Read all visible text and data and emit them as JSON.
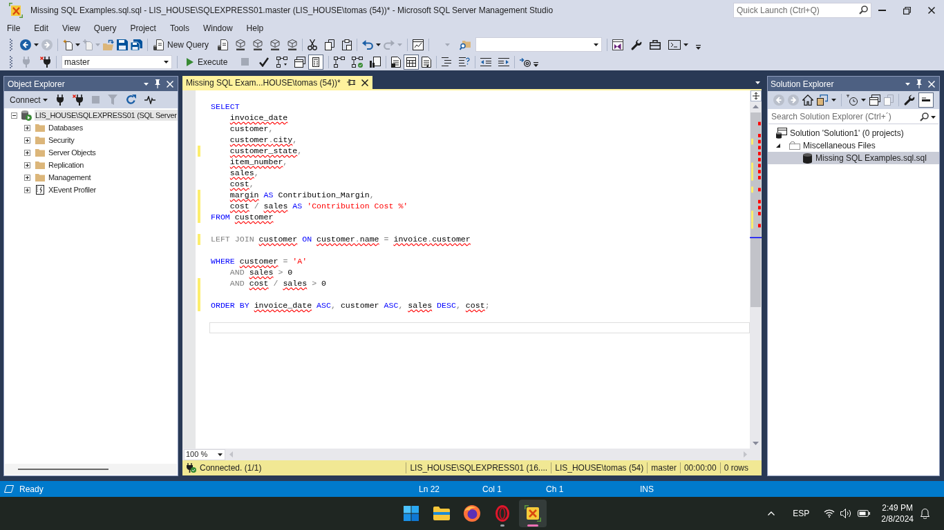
{
  "window": {
    "title": "Missing SQL Examples.sql.sql - LIS_HOUSE\\SQLEXPRESS01.master (LIS_HOUSE\\tomas (54))* - Microsoft SQL Server Management Studio",
    "quick_launch": {
      "placeholder": "Quick Launch (Ctrl+Q)"
    }
  },
  "menu": [
    "File",
    "Edit",
    "View",
    "Query",
    "Project",
    "Tools",
    "Window",
    "Help"
  ],
  "toolbar": {
    "new_query": "New Query",
    "database": "master",
    "execute": "Execute"
  },
  "object_explorer": {
    "title": "Object Explorer",
    "connect": "Connect",
    "tree": [
      {
        "label": "LIS_HOUSE\\SQLEXPRESS01 (SQL Server",
        "kind": "server",
        "expanded": true,
        "selected": true,
        "children": [
          {
            "label": "Databases",
            "kind": "folder",
            "expanded": false,
            "selected": false
          },
          {
            "label": "Security",
            "kind": "folder",
            "expanded": false,
            "selected": false
          },
          {
            "label": "Server Objects",
            "kind": "folder",
            "expanded": false,
            "selected": false
          },
          {
            "label": "Replication",
            "kind": "folder",
            "expanded": false,
            "selected": false
          },
          {
            "label": "Management",
            "kind": "folder",
            "expanded": false,
            "selected": false
          },
          {
            "label": "XEvent Profiler",
            "kind": "profiler",
            "expanded": false,
            "selected": false
          }
        ]
      }
    ]
  },
  "editor": {
    "tabs": [
      {
        "title": "Missing SQL Exam...HOUSE\\tomas (54))*",
        "selected": true
      }
    ],
    "lines": [
      {
        "changed": false,
        "current": false
      },
      {
        "changed": false,
        "current": false,
        "indented": false,
        "tokens": [
          {
            "text": "SELECT",
            "kind": "keyword",
            "error": false
          }
        ]
      },
      {
        "changed": false,
        "current": false,
        "indented": true,
        "tokens": [
          {
            "text": "invoice_date",
            "kind": "identifier",
            "error": true
          }
        ]
      },
      {
        "changed": false,
        "current": false,
        "indented": true,
        "tokens": [
          {
            "text": "customer",
            "kind": "identifier",
            "error": false
          },
          {
            "text": ",",
            "kind": "operator",
            "error": false
          }
        ]
      },
      {
        "changed": false,
        "current": false,
        "indented": true,
        "tokens": [
          {
            "text": "customer",
            "kind": "identifier",
            "error": true
          },
          {
            "text": ".",
            "kind": "operator",
            "error": true
          },
          {
            "text": "city",
            "kind": "identifier",
            "error": true
          },
          {
            "text": ",",
            "kind": "operator",
            "error": false
          }
        ]
      },
      {
        "changed": true,
        "current": false,
        "indented": true,
        "tokens": [
          {
            "text": "customer_state",
            "kind": "identifier",
            "error": true
          },
          {
            "text": ",",
            "kind": "operator",
            "error": false
          }
        ]
      },
      {
        "changed": false,
        "current": false,
        "indented": true,
        "tokens": [
          {
            "text": "item_number",
            "kind": "identifier",
            "error": true
          },
          {
            "text": ",",
            "kind": "operator",
            "error": false
          }
        ]
      },
      {
        "changed": false,
        "current": false,
        "indented": true,
        "tokens": [
          {
            "text": "sales",
            "kind": "identifier",
            "error": true
          },
          {
            "text": ",",
            "kind": "operator",
            "error": false
          }
        ]
      },
      {
        "changed": false,
        "current": false,
        "indented": true,
        "tokens": [
          {
            "text": "cost",
            "kind": "identifier",
            "error": true
          },
          {
            "text": ",",
            "kind": "operator",
            "error": false
          }
        ]
      },
      {
        "changed": true,
        "current": false,
        "indented": true,
        "tokens": [
          {
            "text": "margin",
            "kind": "identifier",
            "error": true
          },
          {
            "text": " AS ",
            "kind": "keyword",
            "error": false
          },
          {
            "text": "Contribution_Margin",
            "kind": "identifier",
            "error": false
          },
          {
            "text": ",",
            "kind": "operator",
            "error": false
          }
        ]
      },
      {
        "changed": true,
        "current": false,
        "indented": true,
        "tokens": [
          {
            "text": "cost",
            "kind": "identifier",
            "error": true
          },
          {
            "text": " / ",
            "kind": "operator",
            "error": false
          },
          {
            "text": "sales",
            "kind": "identifier",
            "error": true
          },
          {
            "text": " AS ",
            "kind": "keyword",
            "error": false
          },
          {
            "text": "'Contribution Cost %'",
            "kind": "string",
            "error": false
          }
        ]
      },
      {
        "changed": true,
        "current": false,
        "indented": false,
        "tokens": [
          {
            "text": "FROM ",
            "kind": "keyword",
            "error": false
          },
          {
            "text": "customer",
            "kind": "identifier",
            "error": true
          }
        ]
      },
      {
        "changed": false,
        "current": false
      },
      {
        "changed": true,
        "current": false,
        "indented": false,
        "tokens": [
          {
            "text": "LEFT JOIN ",
            "kind": "operator",
            "error": false
          },
          {
            "text": "customer",
            "kind": "identifier",
            "error": true
          },
          {
            "text": " ON ",
            "kind": "keyword",
            "error": false
          },
          {
            "text": "customer",
            "kind": "identifier",
            "error": true
          },
          {
            "text": ".",
            "kind": "operator",
            "error": true
          },
          {
            "text": "name",
            "kind": "identifier",
            "error": true
          },
          {
            "text": " = ",
            "kind": "operator",
            "error": false
          },
          {
            "text": "invoice",
            "kind": "identifier",
            "error": true
          },
          {
            "text": ".",
            "kind": "operator",
            "error": true
          },
          {
            "text": "customer",
            "kind": "identifier",
            "error": true
          }
        ]
      },
      {
        "changed": false,
        "current": false
      },
      {
        "changed": false,
        "current": false,
        "indented": false,
        "tokens": [
          {
            "text": "WHERE ",
            "kind": "keyword",
            "error": false
          },
          {
            "text": "customer",
            "kind": "identifier",
            "error": true
          },
          {
            "text": " = ",
            "kind": "operator",
            "error": false
          },
          {
            "text": "'A'",
            "kind": "string",
            "error": false
          }
        ]
      },
      {
        "changed": false,
        "current": false,
        "indented": true,
        "tokens": [
          {
            "text": "AND ",
            "kind": "operator",
            "error": false
          },
          {
            "text": "sales",
            "kind": "identifier",
            "error": true
          },
          {
            "text": " > ",
            "kind": "operator",
            "error": false
          },
          {
            "text": "0",
            "kind": "identifier",
            "error": false
          }
        ]
      },
      {
        "changed": true,
        "current": false,
        "indented": true,
        "tokens": [
          {
            "text": "AND ",
            "kind": "operator",
            "error": false
          },
          {
            "text": "cost",
            "kind": "identifier",
            "error": true
          },
          {
            "text": " / ",
            "kind": "operator",
            "error": false
          },
          {
            "text": "sales",
            "kind": "identifier",
            "error": true
          },
          {
            "text": " > ",
            "kind": "operator",
            "error": false
          },
          {
            "text": "0",
            "kind": "identifier",
            "error": false
          }
        ]
      },
      {
        "changed": true,
        "current": false
      },
      {
        "changed": true,
        "current": false,
        "indented": false,
        "tokens": [
          {
            "text": "ORDER BY ",
            "kind": "keyword",
            "error": false
          },
          {
            "text": "invoice_date",
            "kind": "identifier",
            "error": true
          },
          {
            "text": " ASC",
            "kind": "keyword",
            "error": false
          },
          {
            "text": ", ",
            "kind": "operator",
            "error": false
          },
          {
            "text": "customer",
            "kind": "identifier",
            "error": false
          },
          {
            "text": " ASC",
            "kind": "keyword",
            "error": false
          },
          {
            "text": ", ",
            "kind": "operator",
            "error": false
          },
          {
            "text": "sales",
            "kind": "identifier",
            "error": true
          },
          {
            "text": " DESC",
            "kind": "keyword",
            "error": false
          },
          {
            "text": ", ",
            "kind": "operator",
            "error": false
          },
          {
            "text": "cost",
            "kind": "identifier",
            "error": true
          },
          {
            "text": ";",
            "kind": "operator",
            "error": false
          }
        ]
      },
      {
        "changed": false,
        "current": false
      },
      {
        "changed": false,
        "current": true
      }
    ],
    "zoom": "100 %",
    "query_status": {
      "message": "Connected. (1/1)",
      "server": "LIS_HOUSE\\SQLEXPRESS01 (16....",
      "user": "LIS_HOUSE\\tomas (54)",
      "database": "master",
      "elapsed": "00:00:00",
      "rows": "0 rows"
    }
  },
  "solution_explorer": {
    "title": "Solution Explorer",
    "search": {
      "placeholder": "Search Solution Explorer (Ctrl+´)"
    },
    "tree": [
      {
        "label": "Solution 'Solution1' (0 projects)",
        "kind": "solution",
        "selected": false,
        "children": [
          {
            "label": "Miscellaneous Files",
            "kind": "folder",
            "expanded": true,
            "selected": false,
            "children": [
              {
                "label": "Missing SQL Examples.sql.sql",
                "kind": "file",
                "selected": true
              }
            ]
          }
        ]
      }
    ]
  },
  "status_bar": {
    "message": "Ready",
    "line": "Ln 22",
    "column": "Col 1",
    "character": "Ch 1",
    "mode": "INS"
  },
  "taskbar": {
    "language": "ESP",
    "time": "2:49 PM",
    "date": "2/8/2024"
  }
}
